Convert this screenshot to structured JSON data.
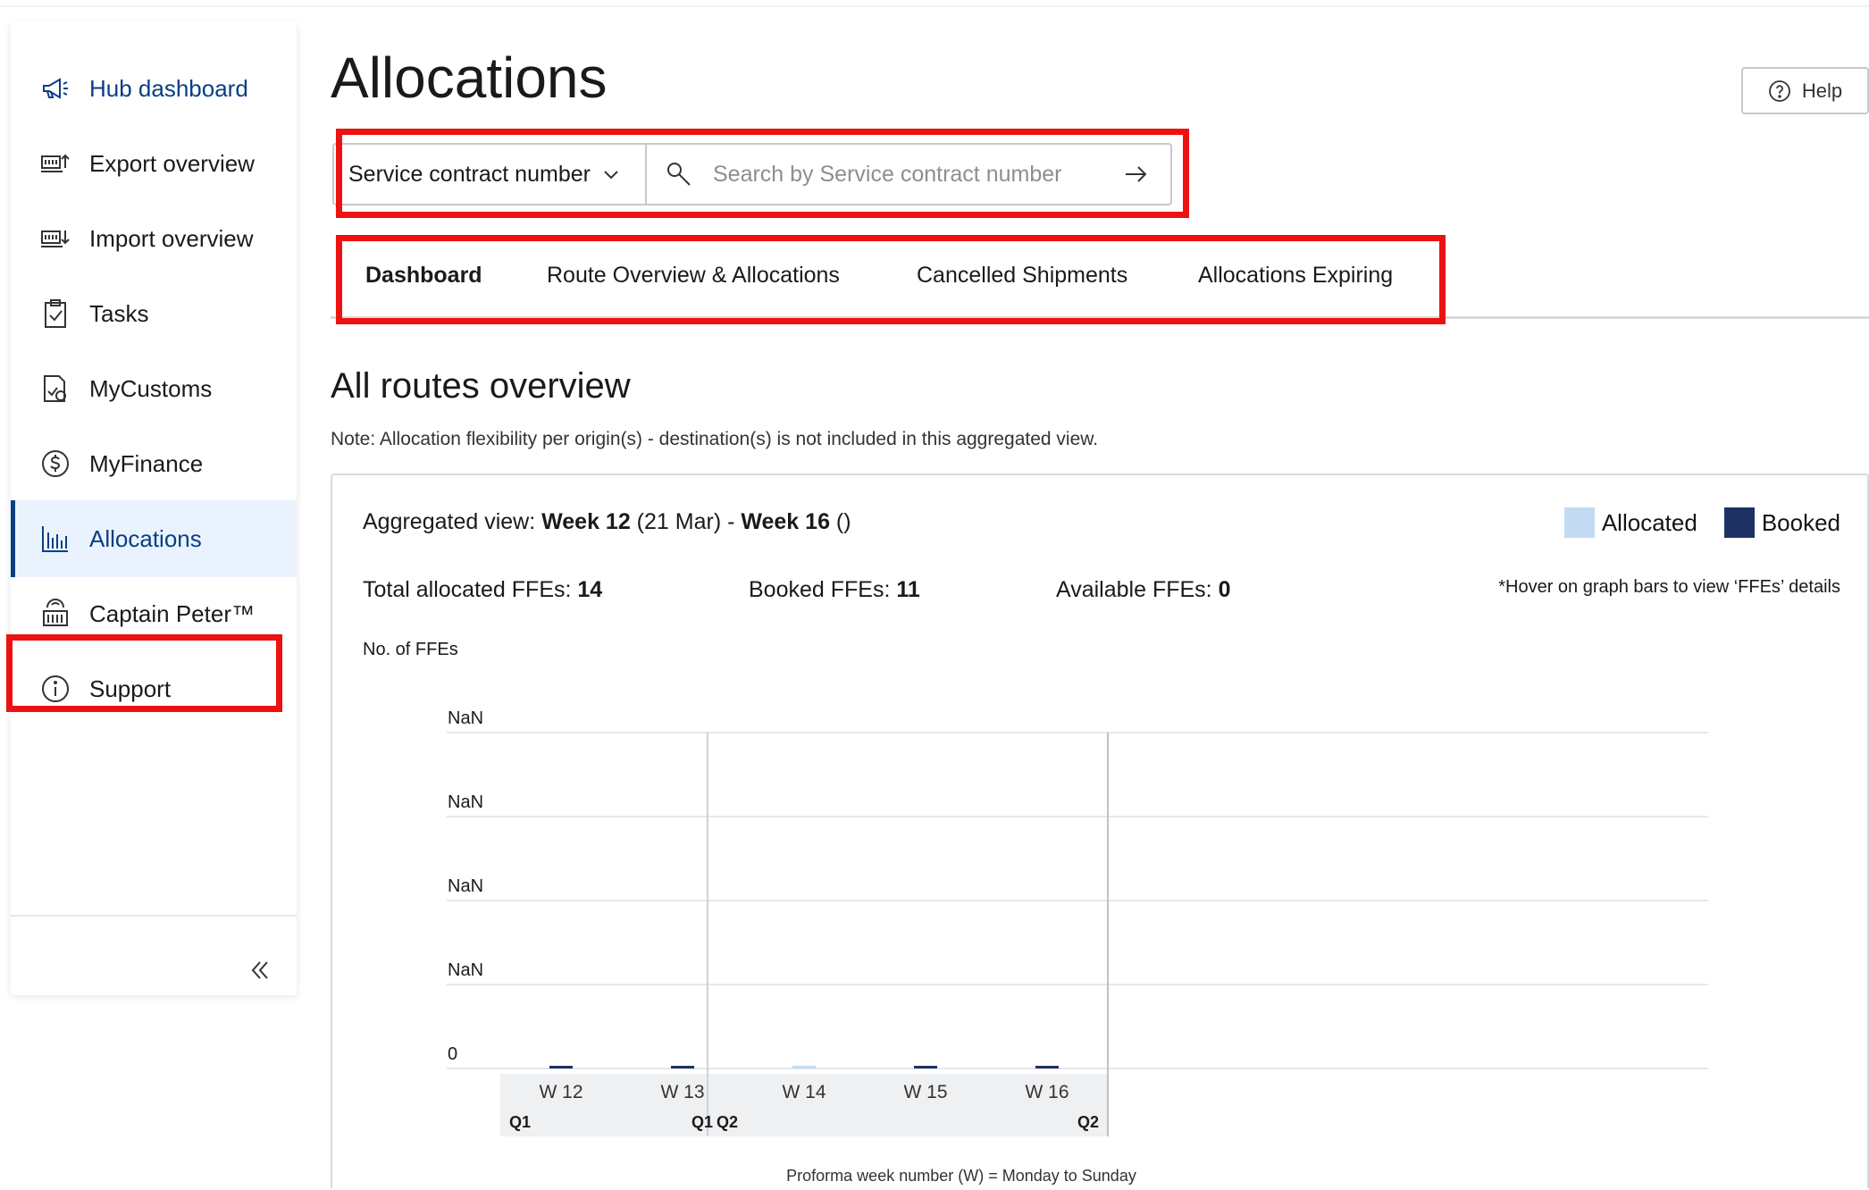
{
  "sidebar": {
    "items": [
      {
        "label": "Hub dashboard",
        "icon": "megaphone-icon"
      },
      {
        "label": "Export overview",
        "icon": "export-icon"
      },
      {
        "label": "Import overview",
        "icon": "import-icon"
      },
      {
        "label": "Tasks",
        "icon": "clipboard-check-icon"
      },
      {
        "label": "MyCustoms",
        "icon": "customs-document-icon"
      },
      {
        "label": "MyFinance",
        "icon": "dollar-circle-icon"
      },
      {
        "label": "Allocations",
        "icon": "bar-chart-icon"
      },
      {
        "label": "Captain Peter™",
        "icon": "container-icon"
      },
      {
        "label": "Support",
        "icon": "info-circle-icon"
      }
    ],
    "active": "Allocations",
    "collapse_icon": "double-chevron-left-icon"
  },
  "header": {
    "title": "Allocations",
    "help_label": "Help"
  },
  "search": {
    "selected": "Service contract number",
    "placeholder": "Search by Service contract number"
  },
  "tabs": [
    {
      "label": "Dashboard",
      "active": true
    },
    {
      "label": "Route Overview & Allocations",
      "active": false
    },
    {
      "label": "Cancelled Shipments",
      "active": false
    },
    {
      "label": "Allocations Expiring",
      "active": false
    }
  ],
  "section": {
    "title": "All routes overview",
    "note": "Note: Allocation flexibility per origin(s) - destination(s) is not included in this aggregated view."
  },
  "card": {
    "agg_prefix": "Aggregated view: ",
    "agg_from_week": "Week 12",
    "agg_from_date": " (21 Mar) - ",
    "agg_to_week": "Week 16",
    "agg_to_date": " ()",
    "legend": {
      "allocated": "Allocated",
      "booked": "Booked"
    },
    "stats": {
      "total_label": "Total allocated FFEs: ",
      "total_value": "14",
      "booked_label": "Booked FFEs: ",
      "booked_value": "11",
      "available_label": "Available FFEs: ",
      "available_value": "0"
    },
    "hover_note": "*Hover on graph bars to view ‘FFEs’ details",
    "y_axis_label": "No. of FFEs"
  },
  "colors": {
    "allocated": "#c3dcf3",
    "booked": "#1d3263",
    "accent": "#0a3e86",
    "highlight_box": "#ee1111"
  },
  "chart_data": {
    "type": "bar",
    "categories": [
      "W 12",
      "W 13",
      "W 14",
      "W 15",
      "W 16"
    ],
    "series": [
      {
        "name": "Allocated",
        "values": [
          0,
          0,
          0,
          0,
          0
        ]
      },
      {
        "name": "Booked",
        "values": [
          0,
          0,
          0,
          0,
          0
        ]
      }
    ],
    "y_tick_labels": [
      "NaN",
      "NaN",
      "NaN",
      "NaN",
      "0"
    ],
    "quarter_labels": [
      "Q1",
      "Q1",
      "Q2",
      "Q2"
    ],
    "ylabel": "No. of FFEs",
    "xlabel": "Proforma week number (W) = Monday to Sunday",
    "grid": true
  }
}
